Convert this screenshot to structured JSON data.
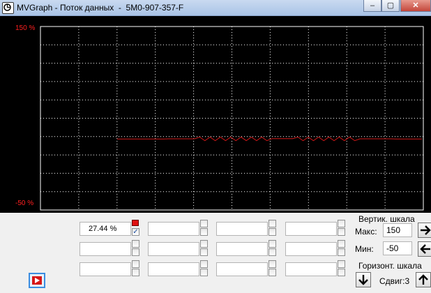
{
  "window": {
    "title": "MVGraph - Поток данных  -  5M0-907-357-F",
    "buttons": {
      "minimize": "‒",
      "maximize": "▢",
      "close": "✕"
    }
  },
  "chart_data": {
    "type": "line",
    "ylim": [
      -50,
      150
    ],
    "y_top_label": "150 %",
    "y_bottom_label": "-50 %",
    "grid": true,
    "line_color": "#d01818",
    "series": [
      {
        "values": [
          27.4,
          27.4,
          27.4,
          27.4,
          27.4,
          27.4,
          27.4,
          27.4,
          27.4,
          27.4,
          27.6,
          27.6,
          27.6,
          27.6,
          27.6,
          27.6,
          29.5,
          25.6,
          29.5,
          25.6,
          29.5,
          25.6,
          29.5,
          25.6,
          29.5,
          25.6,
          29.5,
          25.6,
          29.5,
          25.6,
          27.8,
          27.8,
          27.8,
          27.8,
          27.8,
          29.5,
          25.6,
          29.5,
          25.6,
          29.5,
          25.6,
          29.5,
          25.6,
          29.5,
          25.6,
          29.5,
          25.6,
          27.6,
          27.6,
          27.6,
          27.6,
          27.6,
          27.6,
          27.6,
          27.4,
          27.4,
          27.4,
          27.4,
          27.4,
          27.4
        ]
      }
    ]
  },
  "channels": {
    "row1_value": "27.44 %",
    "row1_checked": true,
    "check_mark": "✓",
    "channel_color": "#e01010"
  },
  "vertical_scale": {
    "title": "Вертик. шкала",
    "max_label": "Макс:",
    "max_value": "150",
    "min_label": "Мин:",
    "min_value": "-50"
  },
  "horizontal_scale": {
    "title": "Горизонт. шкала",
    "shift_label": "Сдвиг:3"
  },
  "icons": {
    "right": "arrow-right-icon",
    "left": "arrow-left-icon",
    "down": "arrow-down-icon",
    "up": "arrow-up-icon",
    "play": "play-icon"
  }
}
